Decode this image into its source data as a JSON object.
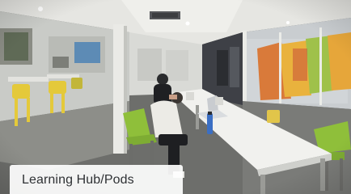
{
  "card": {
    "caption": "Learning Hub/Pods"
  },
  "photo": {
    "scene": "study-hall-interior-icon"
  },
  "colors": {
    "accent_yellow": "#e4c93a",
    "accent_green": "#8fbf3a",
    "caption_text": "#2e3134"
  }
}
